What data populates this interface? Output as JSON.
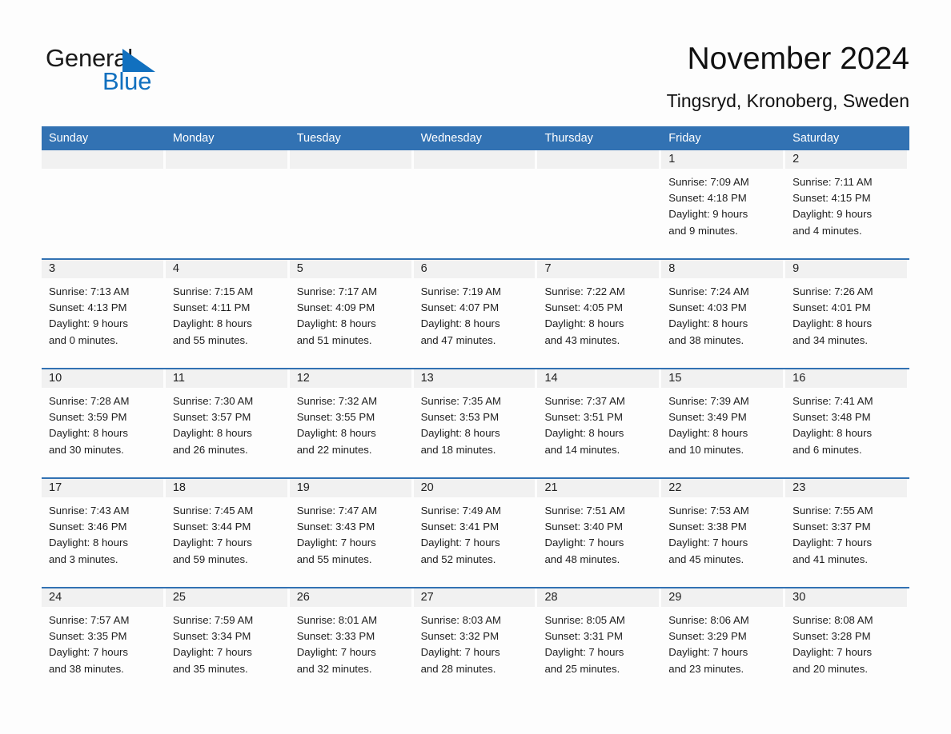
{
  "brand": {
    "name_part1": "General",
    "name_part2": "Blue",
    "triangle_color": "#1170bf",
    "text_color": "#1a1a1a"
  },
  "header": {
    "title": "November 2024",
    "subtitle": "Tingsryd, Kronoberg, Sweden"
  },
  "theme": {
    "header_blue": "#3272b3",
    "numband_gray": "#f1f1f1",
    "page_background": "#fdfdfd",
    "text": "#1d1d1d"
  },
  "weekdays": [
    "Sunday",
    "Monday",
    "Tuesday",
    "Wednesday",
    "Thursday",
    "Friday",
    "Saturday"
  ],
  "weeks": [
    [
      {
        "day": "",
        "sunrise": "",
        "sunset": "",
        "daylight_line1": "",
        "daylight_line2": ""
      },
      {
        "day": "",
        "sunrise": "",
        "sunset": "",
        "daylight_line1": "",
        "daylight_line2": ""
      },
      {
        "day": "",
        "sunrise": "",
        "sunset": "",
        "daylight_line1": "",
        "daylight_line2": ""
      },
      {
        "day": "",
        "sunrise": "",
        "sunset": "",
        "daylight_line1": "",
        "daylight_line2": ""
      },
      {
        "day": "",
        "sunrise": "",
        "sunset": "",
        "daylight_line1": "",
        "daylight_line2": ""
      },
      {
        "day": "1",
        "sunrise": "Sunrise: 7:09 AM",
        "sunset": "Sunset: 4:18 PM",
        "daylight_line1": "Daylight: 9 hours",
        "daylight_line2": "and 9 minutes."
      },
      {
        "day": "2",
        "sunrise": "Sunrise: 7:11 AM",
        "sunset": "Sunset: 4:15 PM",
        "daylight_line1": "Daylight: 9 hours",
        "daylight_line2": "and 4 minutes."
      }
    ],
    [
      {
        "day": "3",
        "sunrise": "Sunrise: 7:13 AM",
        "sunset": "Sunset: 4:13 PM",
        "daylight_line1": "Daylight: 9 hours",
        "daylight_line2": "and 0 minutes."
      },
      {
        "day": "4",
        "sunrise": "Sunrise: 7:15 AM",
        "sunset": "Sunset: 4:11 PM",
        "daylight_line1": "Daylight: 8 hours",
        "daylight_line2": "and 55 minutes."
      },
      {
        "day": "5",
        "sunrise": "Sunrise: 7:17 AM",
        "sunset": "Sunset: 4:09 PM",
        "daylight_line1": "Daylight: 8 hours",
        "daylight_line2": "and 51 minutes."
      },
      {
        "day": "6",
        "sunrise": "Sunrise: 7:19 AM",
        "sunset": "Sunset: 4:07 PM",
        "daylight_line1": "Daylight: 8 hours",
        "daylight_line2": "and 47 minutes."
      },
      {
        "day": "7",
        "sunrise": "Sunrise: 7:22 AM",
        "sunset": "Sunset: 4:05 PM",
        "daylight_line1": "Daylight: 8 hours",
        "daylight_line2": "and 43 minutes."
      },
      {
        "day": "8",
        "sunrise": "Sunrise: 7:24 AM",
        "sunset": "Sunset: 4:03 PM",
        "daylight_line1": "Daylight: 8 hours",
        "daylight_line2": "and 38 minutes."
      },
      {
        "day": "9",
        "sunrise": "Sunrise: 7:26 AM",
        "sunset": "Sunset: 4:01 PM",
        "daylight_line1": "Daylight: 8 hours",
        "daylight_line2": "and 34 minutes."
      }
    ],
    [
      {
        "day": "10",
        "sunrise": "Sunrise: 7:28 AM",
        "sunset": "Sunset: 3:59 PM",
        "daylight_line1": "Daylight: 8 hours",
        "daylight_line2": "and 30 minutes."
      },
      {
        "day": "11",
        "sunrise": "Sunrise: 7:30 AM",
        "sunset": "Sunset: 3:57 PM",
        "daylight_line1": "Daylight: 8 hours",
        "daylight_line2": "and 26 minutes."
      },
      {
        "day": "12",
        "sunrise": "Sunrise: 7:32 AM",
        "sunset": "Sunset: 3:55 PM",
        "daylight_line1": "Daylight: 8 hours",
        "daylight_line2": "and 22 minutes."
      },
      {
        "day": "13",
        "sunrise": "Sunrise: 7:35 AM",
        "sunset": "Sunset: 3:53 PM",
        "daylight_line1": "Daylight: 8 hours",
        "daylight_line2": "and 18 minutes."
      },
      {
        "day": "14",
        "sunrise": "Sunrise: 7:37 AM",
        "sunset": "Sunset: 3:51 PM",
        "daylight_line1": "Daylight: 8 hours",
        "daylight_line2": "and 14 minutes."
      },
      {
        "day": "15",
        "sunrise": "Sunrise: 7:39 AM",
        "sunset": "Sunset: 3:49 PM",
        "daylight_line1": "Daylight: 8 hours",
        "daylight_line2": "and 10 minutes."
      },
      {
        "day": "16",
        "sunrise": "Sunrise: 7:41 AM",
        "sunset": "Sunset: 3:48 PM",
        "daylight_line1": "Daylight: 8 hours",
        "daylight_line2": "and 6 minutes."
      }
    ],
    [
      {
        "day": "17",
        "sunrise": "Sunrise: 7:43 AM",
        "sunset": "Sunset: 3:46 PM",
        "daylight_line1": "Daylight: 8 hours",
        "daylight_line2": "and 3 minutes."
      },
      {
        "day": "18",
        "sunrise": "Sunrise: 7:45 AM",
        "sunset": "Sunset: 3:44 PM",
        "daylight_line1": "Daylight: 7 hours",
        "daylight_line2": "and 59 minutes."
      },
      {
        "day": "19",
        "sunrise": "Sunrise: 7:47 AM",
        "sunset": "Sunset: 3:43 PM",
        "daylight_line1": "Daylight: 7 hours",
        "daylight_line2": "and 55 minutes."
      },
      {
        "day": "20",
        "sunrise": "Sunrise: 7:49 AM",
        "sunset": "Sunset: 3:41 PM",
        "daylight_line1": "Daylight: 7 hours",
        "daylight_line2": "and 52 minutes."
      },
      {
        "day": "21",
        "sunrise": "Sunrise: 7:51 AM",
        "sunset": "Sunset: 3:40 PM",
        "daylight_line1": "Daylight: 7 hours",
        "daylight_line2": "and 48 minutes."
      },
      {
        "day": "22",
        "sunrise": "Sunrise: 7:53 AM",
        "sunset": "Sunset: 3:38 PM",
        "daylight_line1": "Daylight: 7 hours",
        "daylight_line2": "and 45 minutes."
      },
      {
        "day": "23",
        "sunrise": "Sunrise: 7:55 AM",
        "sunset": "Sunset: 3:37 PM",
        "daylight_line1": "Daylight: 7 hours",
        "daylight_line2": "and 41 minutes."
      }
    ],
    [
      {
        "day": "24",
        "sunrise": "Sunrise: 7:57 AM",
        "sunset": "Sunset: 3:35 PM",
        "daylight_line1": "Daylight: 7 hours",
        "daylight_line2": "and 38 minutes."
      },
      {
        "day": "25",
        "sunrise": "Sunrise: 7:59 AM",
        "sunset": "Sunset: 3:34 PM",
        "daylight_line1": "Daylight: 7 hours",
        "daylight_line2": "and 35 minutes."
      },
      {
        "day": "26",
        "sunrise": "Sunrise: 8:01 AM",
        "sunset": "Sunset: 3:33 PM",
        "daylight_line1": "Daylight: 7 hours",
        "daylight_line2": "and 32 minutes."
      },
      {
        "day": "27",
        "sunrise": "Sunrise: 8:03 AM",
        "sunset": "Sunset: 3:32 PM",
        "daylight_line1": "Daylight: 7 hours",
        "daylight_line2": "and 28 minutes."
      },
      {
        "day": "28",
        "sunrise": "Sunrise: 8:05 AM",
        "sunset": "Sunset: 3:31 PM",
        "daylight_line1": "Daylight: 7 hours",
        "daylight_line2": "and 25 minutes."
      },
      {
        "day": "29",
        "sunrise": "Sunrise: 8:06 AM",
        "sunset": "Sunset: 3:29 PM",
        "daylight_line1": "Daylight: 7 hours",
        "daylight_line2": "and 23 minutes."
      },
      {
        "day": "30",
        "sunrise": "Sunrise: 8:08 AM",
        "sunset": "Sunset: 3:28 PM",
        "daylight_line1": "Daylight: 7 hours",
        "daylight_line2": "and 20 minutes."
      }
    ]
  ]
}
